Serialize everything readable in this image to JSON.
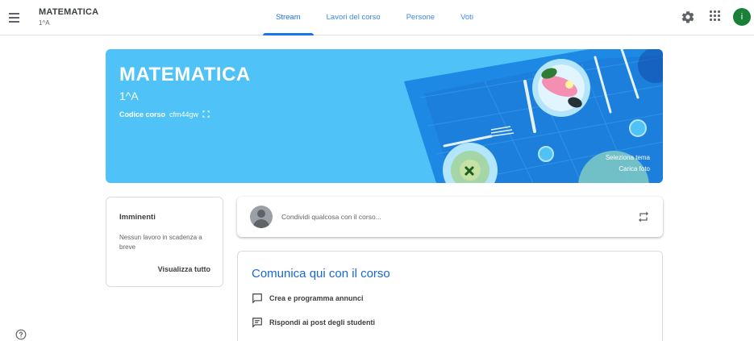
{
  "header": {
    "class_name": "MATEMATICA",
    "class_section": "1^A",
    "tabs": [
      {
        "label": "Stream",
        "active": true
      },
      {
        "label": "Lavori del corso",
        "active": false
      },
      {
        "label": "Persone",
        "active": false
      },
      {
        "label": "Voti",
        "active": false
      }
    ],
    "avatar_letter": "i",
    "icons": [
      "menu-icon",
      "gear-icon",
      "apps-grid-icon"
    ]
  },
  "banner": {
    "title": "MATEMATICA",
    "subtitle": "1^A",
    "code_label": "Codice corso",
    "code_value": "cfm44gw",
    "theme_link": "Seleziona tema",
    "photo_link": "Carica foto",
    "color": "#4fc3f7"
  },
  "upcoming": {
    "title": "Imminenti",
    "text": "Nessun lavoro in scadenza a breve",
    "link": "Visualizza tutto"
  },
  "share": {
    "placeholder": "Condividi qualcosa con il corso..."
  },
  "communicate": {
    "title": "Comunica qui con il corso",
    "items": [
      {
        "label": "Crea e programma annunci",
        "icon": "announcement-icon"
      },
      {
        "label": "Rispondi ai post degli studenti",
        "icon": "reply-post-icon"
      }
    ]
  },
  "colors": {
    "accent": "#1a73e8",
    "avatar": "#188038"
  }
}
